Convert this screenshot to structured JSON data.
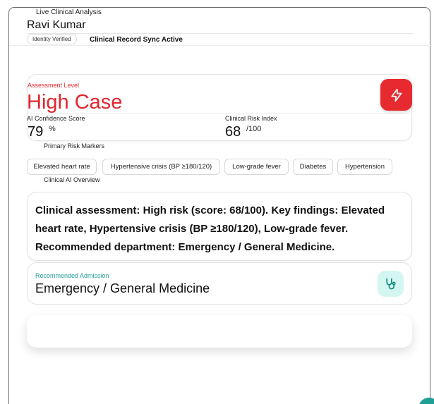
{
  "header": {
    "label": "Live Clinical Analysis",
    "patient_name": "Ravi Kumar",
    "verified_badge": "Identity Verified",
    "sync_status": "Clinical Record Sync Active"
  },
  "assessment": {
    "label": "Assessment Level",
    "value": "High Case",
    "icon": "lightning-bolt-icon",
    "confidence_label": "AI Confidence Score",
    "confidence_value": "79",
    "confidence_unit": "%",
    "risk_label": "Clinical Risk Index",
    "risk_value": "68",
    "risk_unit": "/100"
  },
  "risk_markers": {
    "label": "Primary Risk Markers",
    "items": [
      "Elevated heart rate",
      "Hypertensive crisis (BP ≥180/120)",
      "Low-grade fever",
      "Diabetes",
      "Hypertension"
    ]
  },
  "overview": {
    "label": "Clinical AI Overview",
    "text": "Clinical assessment: High risk (score: 68/100). Key findings: Elevated heart rate, Hypertensive crisis (BP ≥180/120), Low-grade fever. Recommended department: Emergency / General Medicine."
  },
  "admission": {
    "label": "Recommended Admission",
    "value": "Emergency / General Medicine",
    "icon": "stethoscope-icon"
  },
  "colors": {
    "alert_red": "#e62a2f",
    "teal_accent": "#1f9f96",
    "teal_soft": "#d4f6f0"
  }
}
